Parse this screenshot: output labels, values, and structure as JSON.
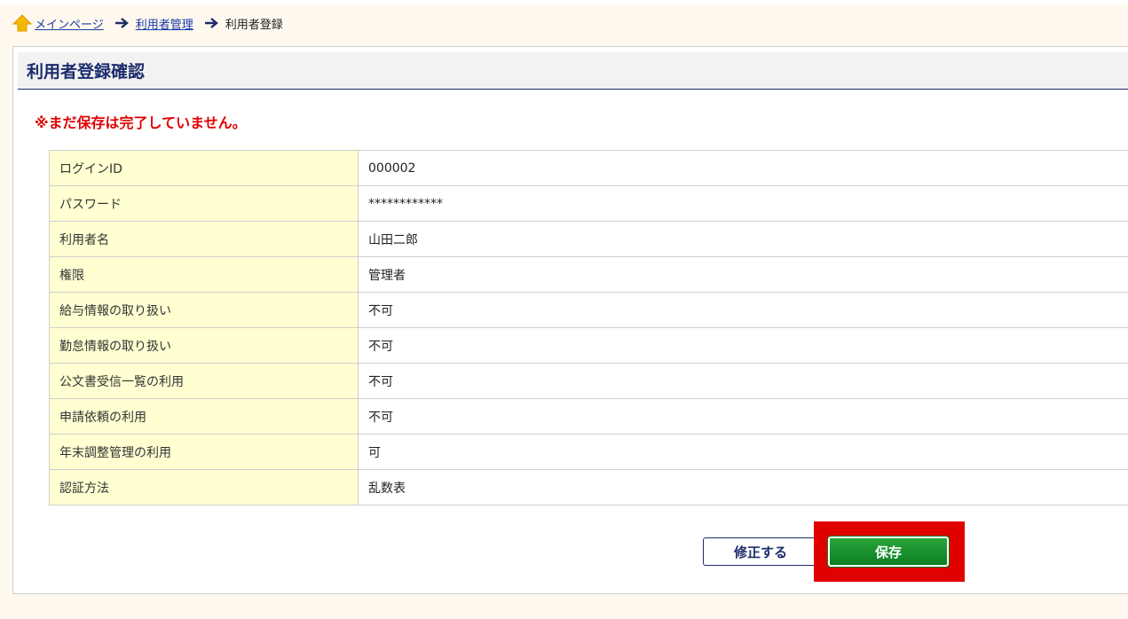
{
  "breadcrumb": {
    "home_label": "メインページ",
    "level2_label": "利用者管理",
    "current_label": "利用者登録"
  },
  "page": {
    "title": "利用者登録確認",
    "warning": "※まだ保存は完了していません。"
  },
  "rows": [
    {
      "label": "ログインID",
      "value": "000002"
    },
    {
      "label": "パスワード",
      "value": "************"
    },
    {
      "label": "利用者名",
      "value": "山田二郎"
    },
    {
      "label": "権限",
      "value": "管理者"
    },
    {
      "label": "給与情報の取り扱い",
      "value": "不可"
    },
    {
      "label": "勤怠情報の取り扱い",
      "value": "不可"
    },
    {
      "label": "公文書受信一覧の利用",
      "value": "不可"
    },
    {
      "label": "申請依頼の利用",
      "value": "不可"
    },
    {
      "label": "年末調整管理の利用",
      "value": "可"
    },
    {
      "label": "認証方法",
      "value": "乱数表"
    }
  ],
  "actions": {
    "edit_label": "修正する",
    "save_label": "保存"
  },
  "colors": {
    "accent_navy": "#1d2c6b",
    "warning_red": "#e00000",
    "save_green": "#1a8f2e",
    "label_bg": "#ffffd2",
    "highlight_red": "#e00000"
  }
}
